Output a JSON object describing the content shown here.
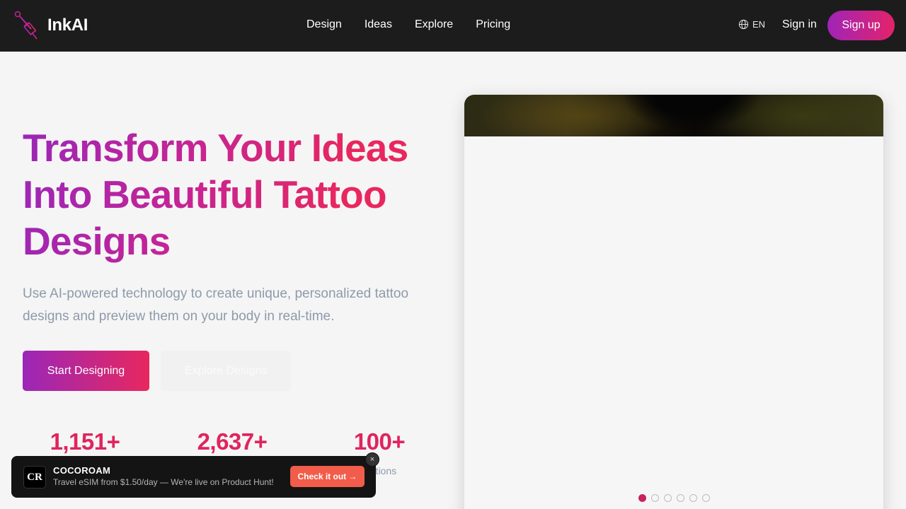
{
  "nav": {
    "brand": "InkAI",
    "links": [
      "Design",
      "Ideas",
      "Explore",
      "Pricing"
    ],
    "lang": "EN",
    "sign_in": "Sign in",
    "sign_up": "Sign up"
  },
  "hero": {
    "title": "Transform Your Ideas Into Beautiful Tattoo Designs",
    "subtitle": "Use AI-powered technology to create unique, personalized tattoo designs and preview them on your body in real-time.",
    "primary_cta": "Start Designing",
    "secondary_cta": "Explore Designs"
  },
  "stats": [
    {
      "value": "1,151+",
      "label": ""
    },
    {
      "value": "2,637+",
      "label": ""
    },
    {
      "value": "100+",
      "label": "Options"
    }
  ],
  "carousel": {
    "slide_count": 6,
    "active_index": 0
  },
  "promo": {
    "logo_text": "CR",
    "name": "COCOROAM",
    "description": "Travel eSIM from $1.50/day — We're live on Product Hunt!",
    "cta": "Check it out →",
    "close": "×"
  },
  "colors": {
    "nav_bg": "#1c1c1c",
    "accent_start": "#9b27b8",
    "accent_end": "#e8275e",
    "promo_cta": "#f25c4a"
  },
  "icons": {
    "logo": "tattoo-needle-icon",
    "lang": "globe-icon",
    "close": "close-icon"
  }
}
